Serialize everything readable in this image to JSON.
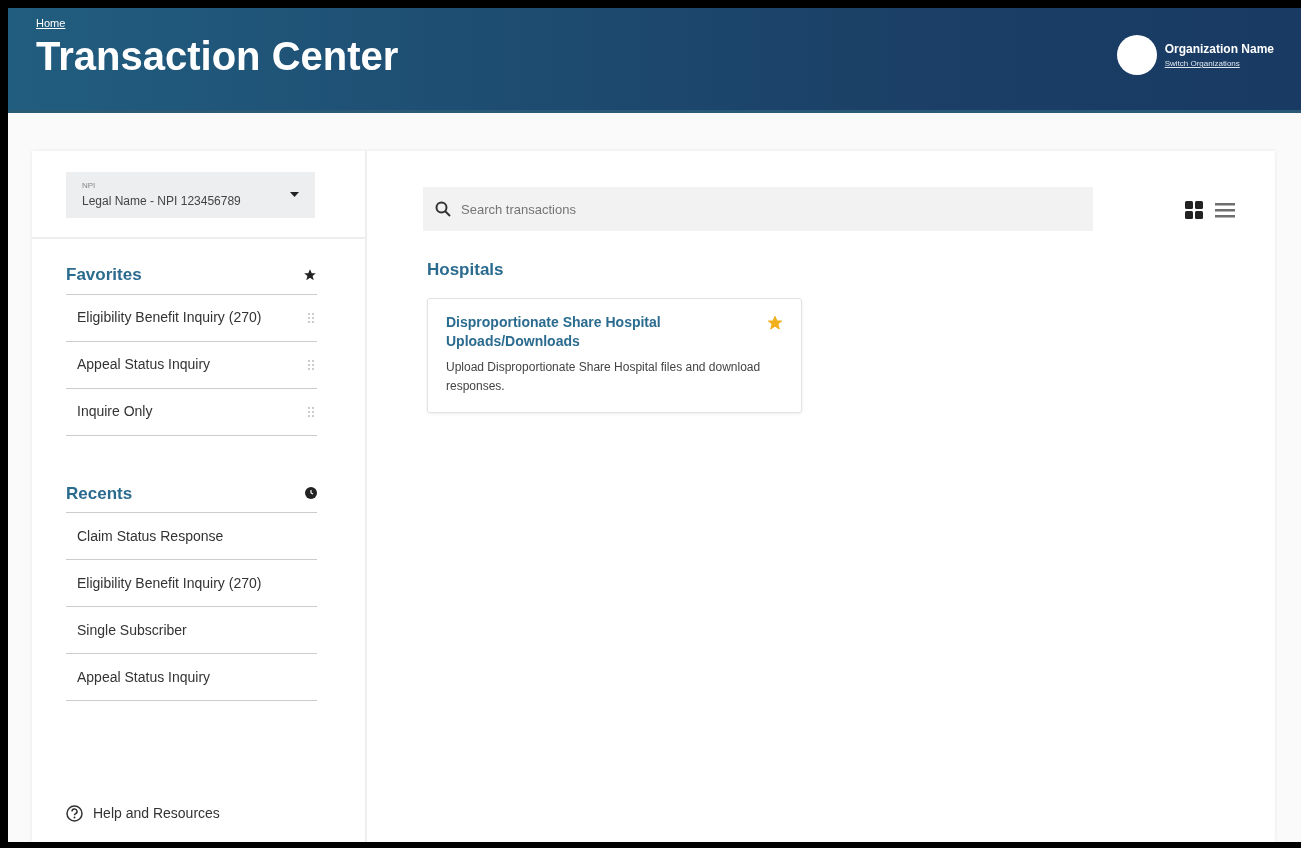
{
  "header": {
    "breadcrumb": "Home",
    "title": "Transaction Center",
    "organization": {
      "name": "Organization Name",
      "switch_link": "Switch Organizations"
    }
  },
  "sidebar": {
    "npi_select": {
      "label": "NPI",
      "value": "Legal Name - NPI 123456789"
    },
    "favorites": {
      "title": "Favorites",
      "items": [
        {
          "label": "Eligibility Benefit Inquiry (270)"
        },
        {
          "label": "Appeal Status Inquiry"
        },
        {
          "label": "Inquire Only"
        }
      ]
    },
    "recents": {
      "title": "Recents",
      "items": [
        {
          "label": "Claim Status Response"
        },
        {
          "label": "Eligibility Benefit Inquiry (270)"
        },
        {
          "label": "Single Subscriber"
        },
        {
          "label": "Appeal Status Inquiry"
        }
      ]
    },
    "help_link": "Help and Resources"
  },
  "main": {
    "search": {
      "placeholder": "Search transactions"
    },
    "view_modes": [
      {
        "kind": "grid",
        "selected": true
      },
      {
        "kind": "list",
        "selected": false
      }
    ],
    "sections": [
      {
        "title": "Hospitals",
        "cards": [
          {
            "title": "Disproportionate Share Hospital Uploads/Downloads",
            "description": "Upload Disproportionate Share Hospital files and download responses.",
            "favorite": true
          }
        ]
      }
    ]
  }
}
